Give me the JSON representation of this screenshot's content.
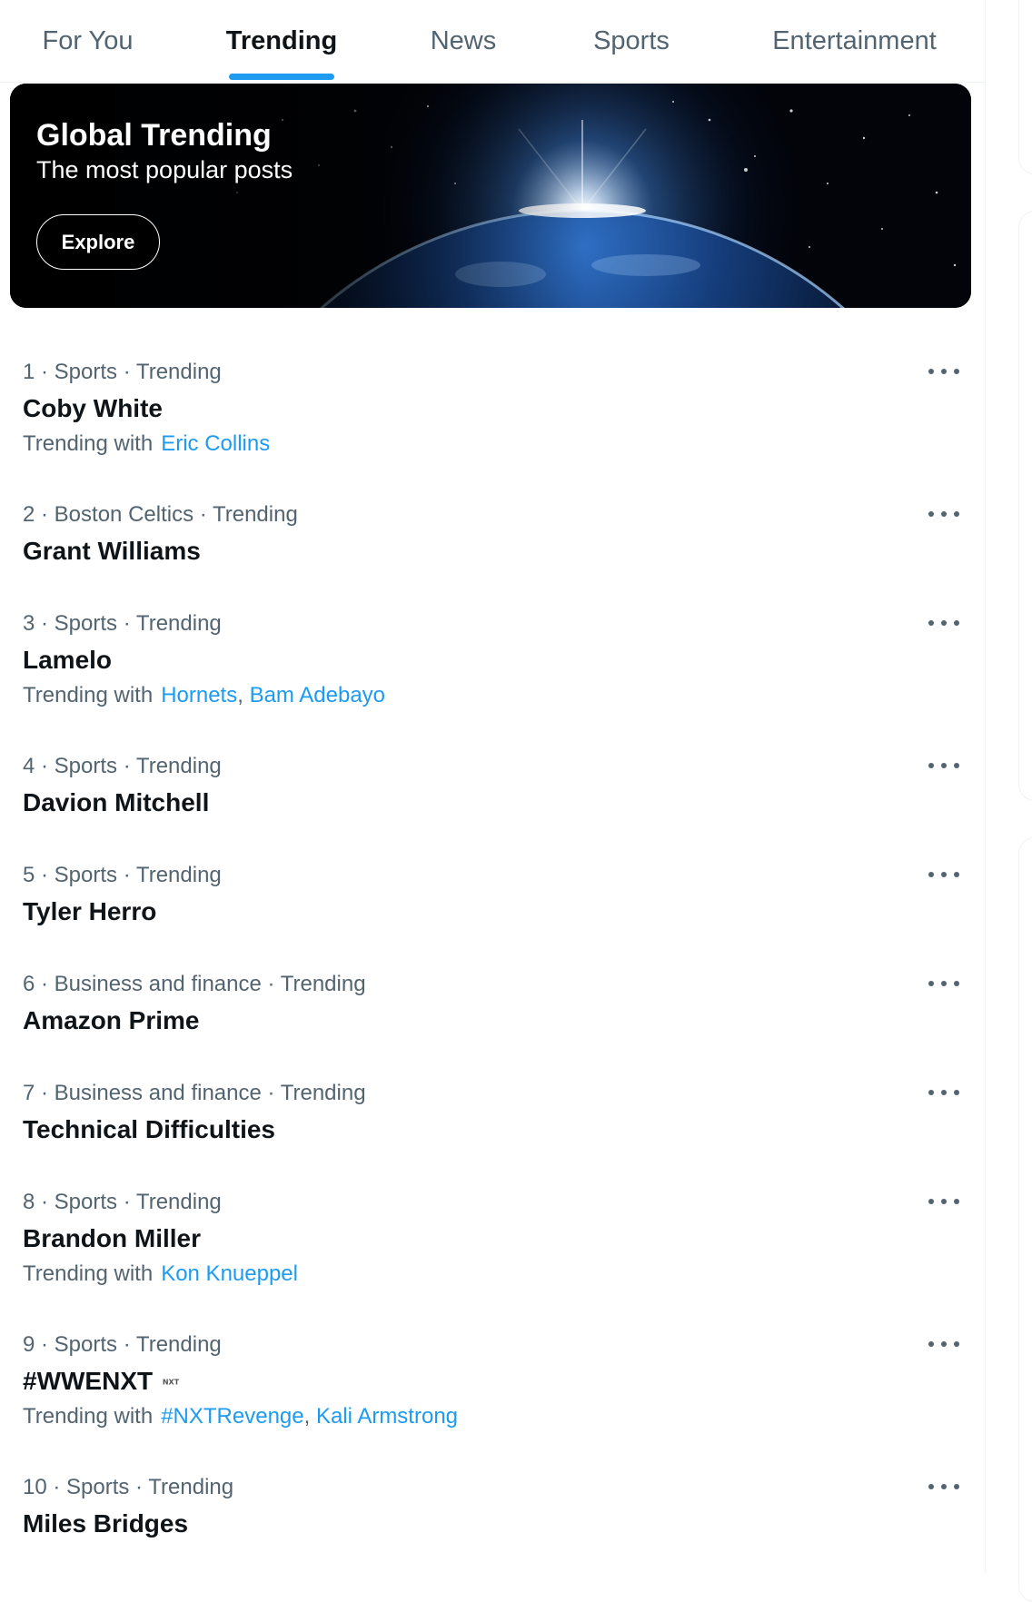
{
  "tabs": [
    {
      "label": "For You",
      "active": false
    },
    {
      "label": "Trending",
      "active": true
    },
    {
      "label": "News",
      "active": false
    },
    {
      "label": "Sports",
      "active": false
    },
    {
      "label": "Entertainment",
      "active": false
    }
  ],
  "banner": {
    "title": "Global Trending",
    "subtitle": "The most popular posts",
    "button_label": "Explore"
  },
  "trends": [
    {
      "rank": "1",
      "meta": "1 · Sports · Trending",
      "title": "Coby White",
      "with_label": "Trending with",
      "with": [
        "Eric Collins"
      ]
    },
    {
      "rank": "2",
      "meta": "2 · Boston Celtics · Trending",
      "title": "Grant Williams",
      "with_label": "",
      "with": []
    },
    {
      "rank": "3",
      "meta": "3 · Sports · Trending",
      "title": "Lamelo",
      "with_label": "Trending with",
      "with": [
        "Hornets",
        "Bam Adebayo"
      ]
    },
    {
      "rank": "4",
      "meta": "4 · Sports · Trending",
      "title": "Davion Mitchell",
      "with_label": "",
      "with": []
    },
    {
      "rank": "5",
      "meta": "5 · Sports · Trending",
      "title": "Tyler Herro",
      "with_label": "",
      "with": []
    },
    {
      "rank": "6",
      "meta": "6 · Business and finance · Trending",
      "title": "Amazon Prime",
      "with_label": "",
      "with": []
    },
    {
      "rank": "7",
      "meta": "7 · Business and finance · Trending",
      "title": "Technical Difficulties",
      "with_label": "",
      "with": []
    },
    {
      "rank": "8",
      "meta": "8 · Sports · Trending",
      "title": "Brandon Miller",
      "with_label": "Trending with",
      "with": [
        "Kon Knueppel"
      ]
    },
    {
      "rank": "9",
      "meta": "9 · Sports · Trending",
      "title": "#WWENXT",
      "with_label": "Trending with",
      "with": [
        "#NXTRevenge",
        "Kali Armstrong"
      ]
    },
    {
      "rank": "10",
      "meta": "10 · Sports · Trending",
      "title": "Miles Bridges",
      "with_label": "",
      "with": []
    }
  ],
  "colors": {
    "accent": "#1d9bf0",
    "text_primary": "#0f1419",
    "text_secondary": "#536471",
    "border": "#eff3f4"
  },
  "icons": {
    "more": "more-horizontal-icon",
    "nxt_badge": "nxt-logo-icon"
  }
}
